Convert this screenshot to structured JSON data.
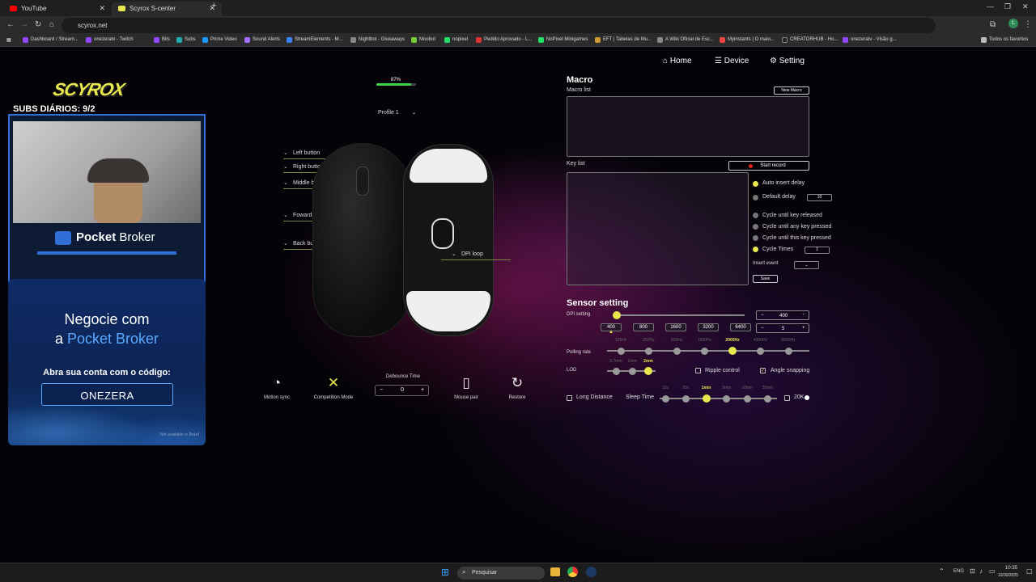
{
  "browser": {
    "tabs": [
      {
        "label": "YouTube"
      },
      {
        "label": "Scyrox S-center"
      }
    ],
    "address": "scyrox.net",
    "bookmarks": [
      "Dashboard / Stream...",
      "onezeratv - Twitch",
      "Bits",
      "Subs",
      "Prime Video",
      "Sound Alerts",
      "StreamElements - M...",
      "Nightbot - Giveaways",
      "Moobot",
      "nopixel",
      "Pedido Aprovado - L...",
      "NoPixel Minigames",
      "EFT | Tabelas de Mu...",
      "A Wiki Oficial de Esc...",
      "Myinstants | O maio...",
      "CREATORHUB - Ho...",
      "onezeratv - Visão g..."
    ],
    "all_bookmarks": "Todos os favoritos",
    "profile_initial": "L"
  },
  "overlay": {
    "logo": "SCYROX",
    "subs": "SUBS DIÁRIOS: 9/2",
    "sponsor_pre": "Pocket",
    "sponsor_post": "Broker",
    "promo_line1": "Negocie com",
    "promo_line2_pre": "a",
    "promo_line2_brand": "Pocket Broker",
    "promo_cta": "Abra sua conta com o código:",
    "promo_code": "ONEZERA",
    "promo_note": "Not available in Brazil"
  },
  "app": {
    "menu": {
      "home": "Home",
      "device": "Device",
      "setting": "Setting"
    },
    "battery": "87%",
    "battery_level": 0.87,
    "profile": "Profile 1",
    "buttons": {
      "left": "Left button",
      "right": "Right button",
      "middle": "Middle button",
      "forward": "Foward button",
      "back": "Back button",
      "dpi_loop": "DPI loop"
    },
    "bottom": {
      "motion_sync": "Motion sync",
      "competition": "Competition Mode",
      "debounce_title": "Debounce Time",
      "debounce_value": "0",
      "minus": "−",
      "plus": "+",
      "mouse_pair": "Mouse pair",
      "restore": "Restore"
    },
    "macro": {
      "title": "Macro",
      "macro_list": "Macro list",
      "new_macro": "New Macro",
      "key_list": "Key list",
      "start_record": "Start record",
      "auto_insert": "Auto insert delay",
      "default_delay": "Default delay",
      "default_delay_value": "10",
      "cycle_release": "Cycle until key released",
      "cycle_any": "Cycle until any key pressed",
      "cycle_this": "Cycle until this key pressed",
      "cycle_times": "Cycle Times",
      "cycle_times_value": "1",
      "insert_event": "Insert event",
      "save": "Save"
    },
    "sensor": {
      "title": "Sensor setting",
      "dpi_label": "DPI setting",
      "dpi_value": "400",
      "dpi_count": "5",
      "dpi_presets": [
        "400",
        "800",
        "1600",
        "3200",
        "6400"
      ],
      "polling_label": "Polling rate",
      "polling_options": [
        "125Hz",
        "250Hz",
        "500Hz",
        "1000Hz",
        "2000Hz",
        "4000Hz",
        "8000Hz"
      ],
      "polling_selected": "2000Hz",
      "lod_label": "LOD",
      "lod_options": [
        "0.7mm",
        "1mm",
        "2mm"
      ],
      "lod_selected": "2mm",
      "ripple": "Ripple control",
      "angle": "Angle snapping",
      "long_distance": "Long Distance",
      "sleep_label": "Sleep Time",
      "sleep_options": [
        "10s",
        "30s",
        "1min",
        "5min",
        "10min",
        "30min"
      ],
      "sleep_selected": "1min",
      "k20": "20K"
    }
  },
  "taskbar": {
    "search": "Pesquisar",
    "lang": "ENG",
    "time": "10:35",
    "date": "10/30/2025"
  },
  "colors": {
    "accent": "#e8e84e",
    "brand_blue": "#2f6fd6",
    "battery": "#3fd54a",
    "record": "#e02020"
  }
}
